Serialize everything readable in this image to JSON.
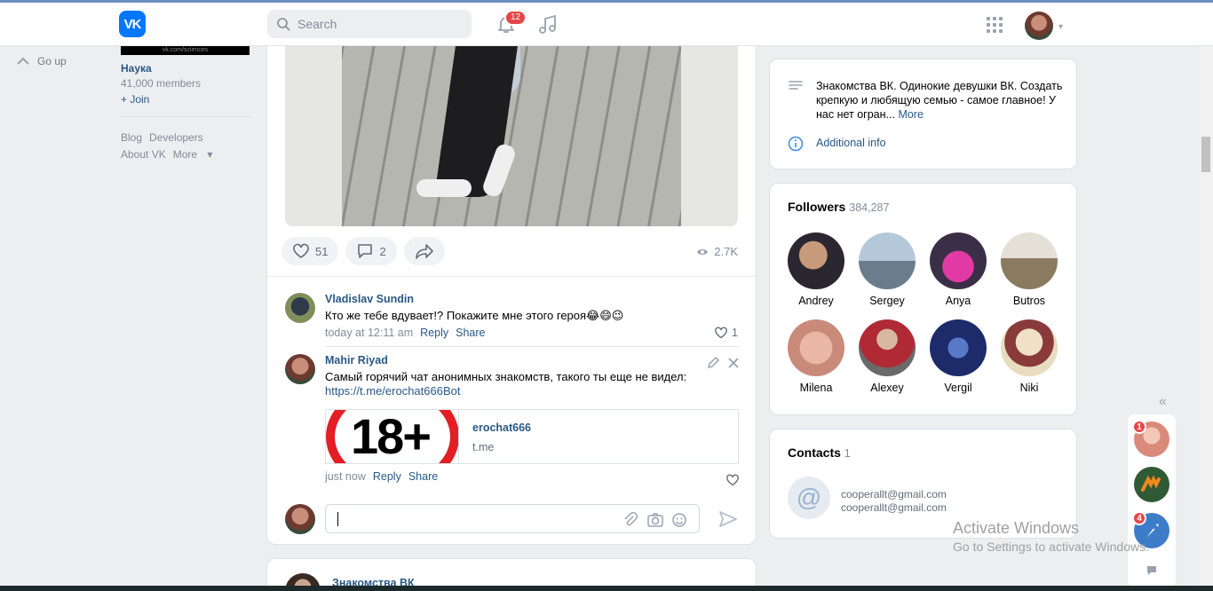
{
  "header": {
    "logo": "VK",
    "search_placeholder": "Search",
    "notifications_count": "12"
  },
  "left": {
    "go_up": "Go up",
    "banner_text": "vk.com/sciences",
    "group_name": "Наука",
    "group_members": "41,000 members",
    "join": "+ Join",
    "links": [
      "Blog",
      "Developers",
      "About VK",
      "More"
    ]
  },
  "post": {
    "likes": "51",
    "comments": "2",
    "views": "2.7K"
  },
  "comments": [
    {
      "author": "Vladislav Sundin",
      "text": "Кто же тебе вдувает!? Покажите мне этого героя😂😄😉",
      "time": "today at 12:11 am",
      "reply": "Reply",
      "share": "Share",
      "likes": "1"
    },
    {
      "author": "Mahir Riyad",
      "text": "Самый горячий чат анонимных знакомств, такого ты еще не видел:",
      "link": "https://t.me/erochat666Bot",
      "card_image_text": "18+",
      "card_title": "erochat666",
      "card_domain": "t.me",
      "time": "just now",
      "reply": "Reply",
      "share": "Share"
    }
  ],
  "next_post": {
    "author": "Знакомства ВК"
  },
  "about": {
    "description": "Знакомства ВК. Одинокие девушки ВК. Создать крепкую и любящую семью - самое главное! У нас нет огран...",
    "more": "More",
    "additional_info": "Additional info"
  },
  "followers": {
    "title": "Followers",
    "count": "384,287",
    "items": [
      {
        "name": "Andrey",
        "color": "#3b3a44"
      },
      {
        "name": "Sergey",
        "color": "#9fb3c8"
      },
      {
        "name": "Anya",
        "color": "#d43c9a"
      },
      {
        "name": "Butros",
        "color": "#d8cdb8"
      },
      {
        "name": "Milena",
        "color": "#e9b7a3"
      },
      {
        "name": "Alexey",
        "color": "#b02a36"
      },
      {
        "name": "Vergil",
        "color": "#1d2b6b"
      },
      {
        "name": "Niki",
        "color": "#e8dcc0"
      }
    ]
  },
  "contacts": {
    "title": "Contacts",
    "count": "1",
    "email1": "cooperallt@gmail.com",
    "email2": "cooperallt@gmail.com"
  },
  "chats": [
    {
      "badge": "1",
      "color": "#d98a7a"
    },
    {
      "badge": "",
      "color": "#2f5a35"
    },
    {
      "badge": "4",
      "color": "#3d7cc9"
    }
  ],
  "windows": {
    "line1": "Activate Windows",
    "line2": "Go to Settings to activate Windows."
  }
}
